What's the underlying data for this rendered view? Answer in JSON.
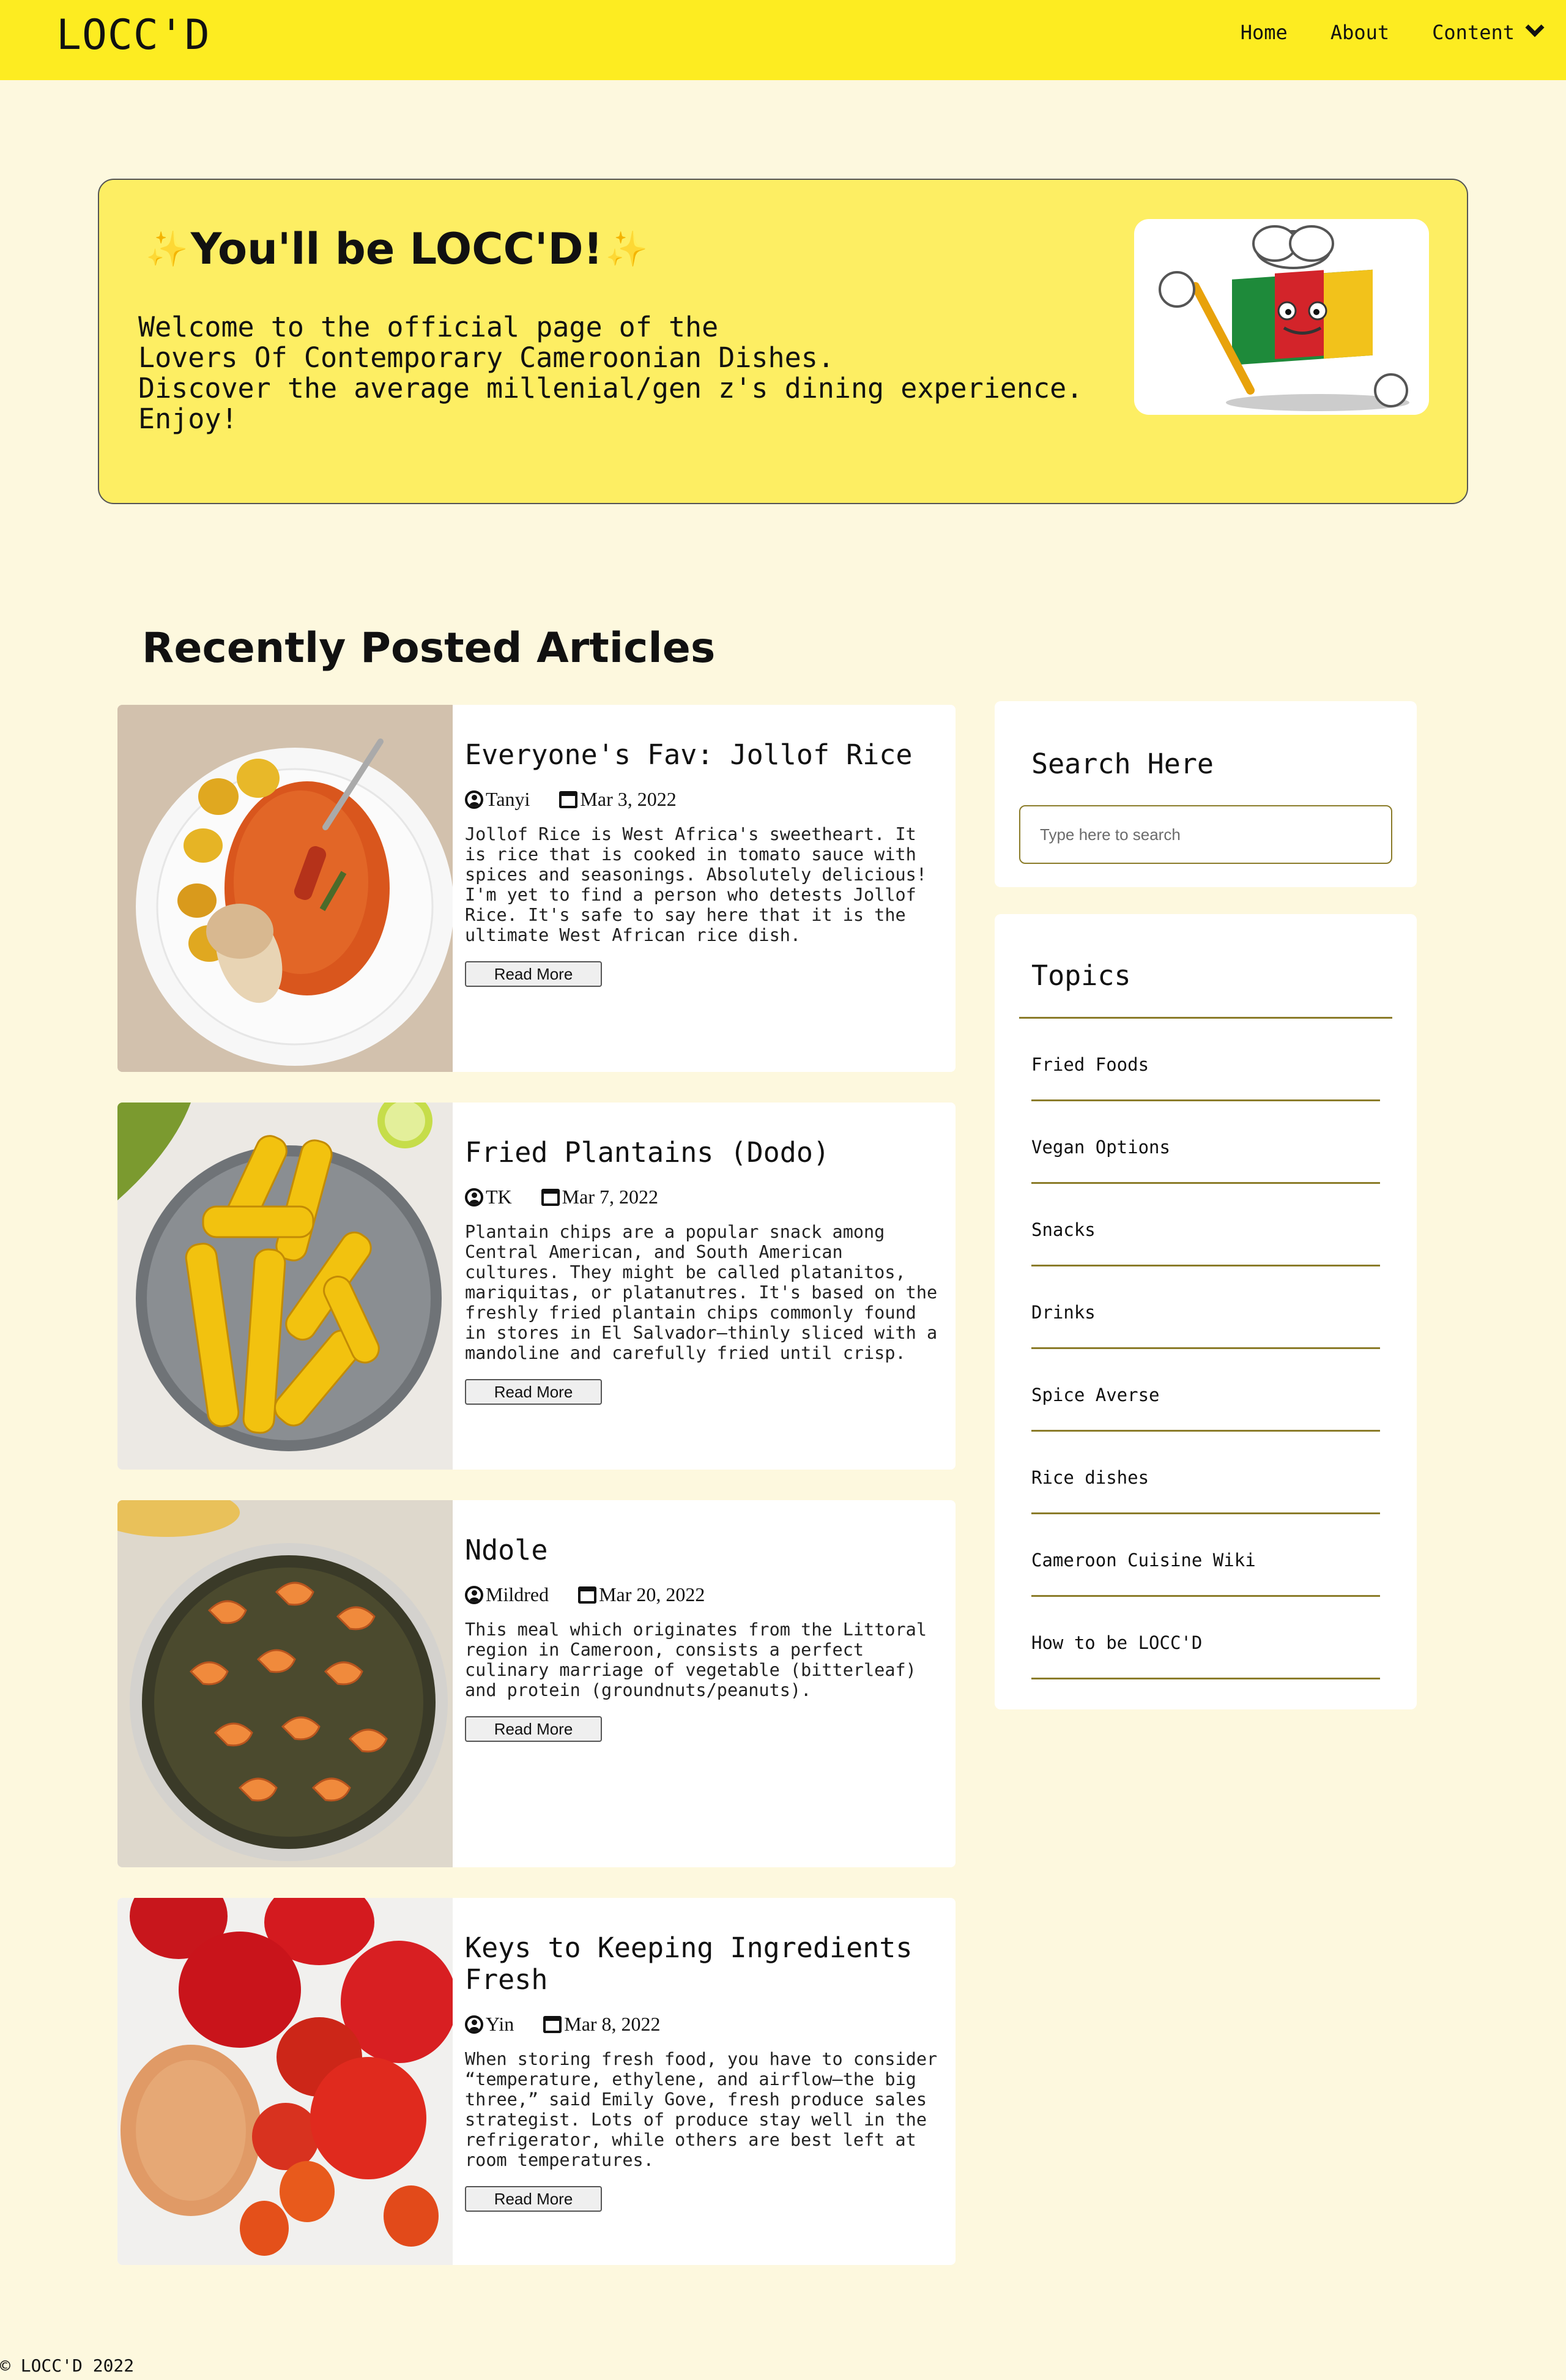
{
  "nav": {
    "brand": "LOCC'D",
    "links": [
      "Home",
      "About",
      "Content"
    ]
  },
  "hero": {
    "title": "You'll be LOCC'D!",
    "text": "Welcome to the official page of the\nLovers Of Contemporary Cameroonian Dishes.\nDiscover the average millenial/gen z's dining experience.\nEnjoy!",
    "image_alt": "chef-flag-mascot"
  },
  "section_title": "Recently Posted Articles",
  "articles": [
    {
      "title": "Everyone's Fav: Jollof Rice",
      "author": "Tanyi",
      "date": "Mar 3, 2022",
      "excerpt": "Jollof Rice is West Africa's sweetheart. It is rice that is cooked in tomato sauce with spices and seasonings. Absolutely delicious! I'm yet to find a person who detests Jollof Rice. It's safe to say here that it is the ultimate West African rice dish.",
      "button": "Read More"
    },
    {
      "title": "Fried Plantains (Dodo)",
      "author": "TK",
      "date": "Mar 7, 2022",
      "excerpt": "Plantain chips are a popular snack among Central American, and South American cultures. They might be called platanitos, mariquitas, or platanutres. It's based on the freshly fried plantain chips commonly found in stores in El Salvador—thinly sliced with a mandoline and carefully fried until crisp.",
      "button": "Read More"
    },
    {
      "title": "Ndole",
      "author": "Mildred",
      "date": "Mar 20, 2022",
      "excerpt": "This meal which originates from the Littoral region in Cameroon, consists a perfect culinary marriage of vegetable (bitterleaf) and protein (groundnuts/peanuts).",
      "button": "Read More"
    },
    {
      "title": "Keys to Keeping Ingredients Fresh",
      "author": "Yin",
      "date": "Mar 8, 2022",
      "excerpt": "When storing fresh food, you have to consider “temperature, ethylene, and airflow—the big three,” said Emily Gove, fresh produce sales strategist. Lots of produce stay well in the refrigerator, while others are best left at room temperatures.",
      "button": "Read More"
    }
  ],
  "search": {
    "title": "Search Here",
    "placeholder": "Type here to search"
  },
  "topics": {
    "title": "Topics",
    "items": [
      "Fried Foods",
      "Vegan Options",
      "Snacks",
      "Drinks",
      "Spice Averse",
      "Rice dishes",
      "Cameroon Cuisine Wiki",
      "How to be LOCC'D"
    ]
  },
  "footer": "© LOCC'D 2022",
  "colors": {
    "nav_bg": "#fdec21",
    "page_bg": "#fdf8de",
    "hero_bg": "#fdee63",
    "accent_line": "#8b7c2a"
  }
}
